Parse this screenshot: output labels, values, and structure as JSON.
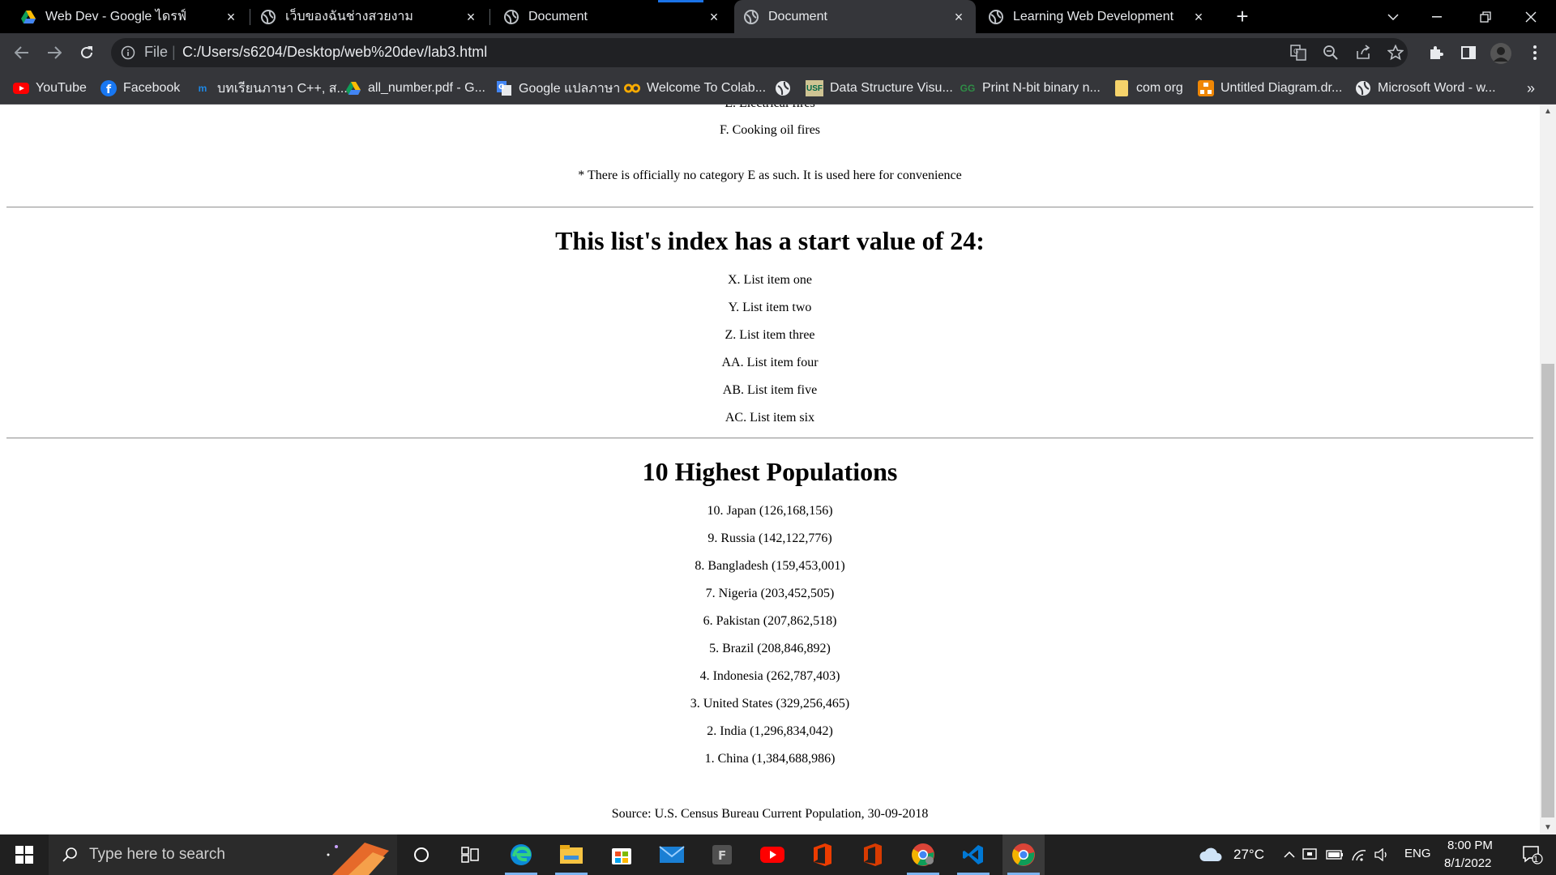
{
  "browser": {
    "tabs": [
      {
        "title": "Web Dev - Google ไดรฟ์",
        "icon": "google-drive-icon",
        "active": false
      },
      {
        "title": "เว็บของฉันช่างสวยงาม",
        "icon": "globe-icon",
        "active": false
      },
      {
        "title": "Document",
        "icon": "globe-icon",
        "active": false
      },
      {
        "title": "Document",
        "icon": "globe-icon",
        "active": true
      },
      {
        "title": "Learning Web Development",
        "icon": "globe-icon",
        "active": false
      }
    ],
    "address": {
      "scheme_label": "File",
      "url": "C:/Users/s6204/Desktop/web%20dev/lab3.html"
    },
    "bookmarks": [
      {
        "label": "YouTube",
        "icon": "youtube-icon",
        "color": "#ff0000"
      },
      {
        "label": "Facebook",
        "icon": "facebook-icon",
        "color": "#1877f2"
      },
      {
        "label": "บทเรียนภาษา C++, ส...",
        "icon": "marcuscode-icon",
        "color": "#1e88e5"
      },
      {
        "label": "all_number.pdf - G...",
        "icon": "google-drive-icon",
        "color": "#fbbc04"
      },
      {
        "label": "Google แปลภาษา",
        "icon": "google-translate-icon",
        "color": "#4285f4"
      },
      {
        "label": "Welcome To Colab...",
        "icon": "colab-icon",
        "color": "#f9ab00"
      },
      {
        "label": "Data Structure Visu...",
        "icon": "usf-icon",
        "color": "#006747"
      },
      {
        "label": "Print N-bit binary n...",
        "icon": "geeksforgeeks-icon",
        "color": "#2f8d46"
      },
      {
        "label": "com org",
        "icon": "folder-icon",
        "color": "#f6d36b"
      },
      {
        "label": "Untitled Diagram.dr...",
        "icon": "drawio-icon",
        "color": "#f08705"
      },
      {
        "label": "Microsoft Word - w...",
        "icon": "globe-icon",
        "color": "#e8eaed"
      }
    ],
    "bookmarks_overflow": "»"
  },
  "page": {
    "prev_list_partial": "E. Electrical fires",
    "prev_list_last": "F. Cooking oil fires",
    "note": "* There is officially no category E as such. It is used here for convenience",
    "start_heading": "This list's index has a start value of 24:",
    "start_list": [
      "X. List item one",
      "Y. List item two",
      "Z. List item three",
      "AA. List item four",
      "AB. List item five",
      "AC. List item six"
    ],
    "pop_heading": "10 Highest Populations",
    "pop_list": [
      "10. Japan (126,168,156)",
      "9. Russia (142,122,776)",
      "8. Bangladesh (159,453,001)",
      "7. Nigeria (203,452,505)",
      "6. Pakistan (207,862,518)",
      "5. Brazil (208,846,892)",
      "4. Indonesia (262,787,403)",
      "3. United States (329,256,465)",
      "2. India (1,296,834,042)",
      "1. China (1,384,688,986)"
    ],
    "source": "Source: U.S. Census Bureau Current Population, 30-09-2018"
  },
  "taskbar": {
    "search_placeholder": "Type here to search",
    "apps": [
      "task-view-icon",
      "edge-icon",
      "file-explorer-icon",
      "store-icon",
      "mail-icon",
      "app-f-icon",
      "youtube-app-icon",
      "office-icon",
      "office-alt-icon",
      "chrome-icon",
      "vscode-icon",
      "chrome-active-icon"
    ],
    "weather": "27°C",
    "language": "ENG",
    "time": "8:00 PM",
    "date": "8/1/2022",
    "notification_count": "1"
  }
}
